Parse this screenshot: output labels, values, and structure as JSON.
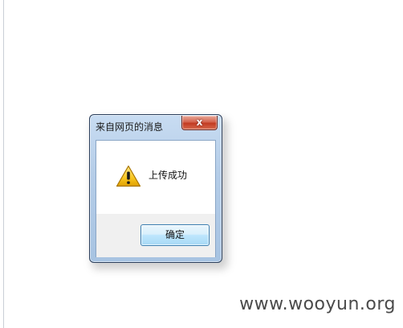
{
  "dialog": {
    "title": "来自网页的消息",
    "close_label": "x",
    "message": "上传成功",
    "ok_label": "确定",
    "icon": "warning-icon"
  },
  "watermark": {
    "text": "www.wooyun.org"
  },
  "colors": {
    "close_button": "#c23b22",
    "ok_button_border": "#3c7fb1",
    "warning_yellow": "#f5c518"
  }
}
